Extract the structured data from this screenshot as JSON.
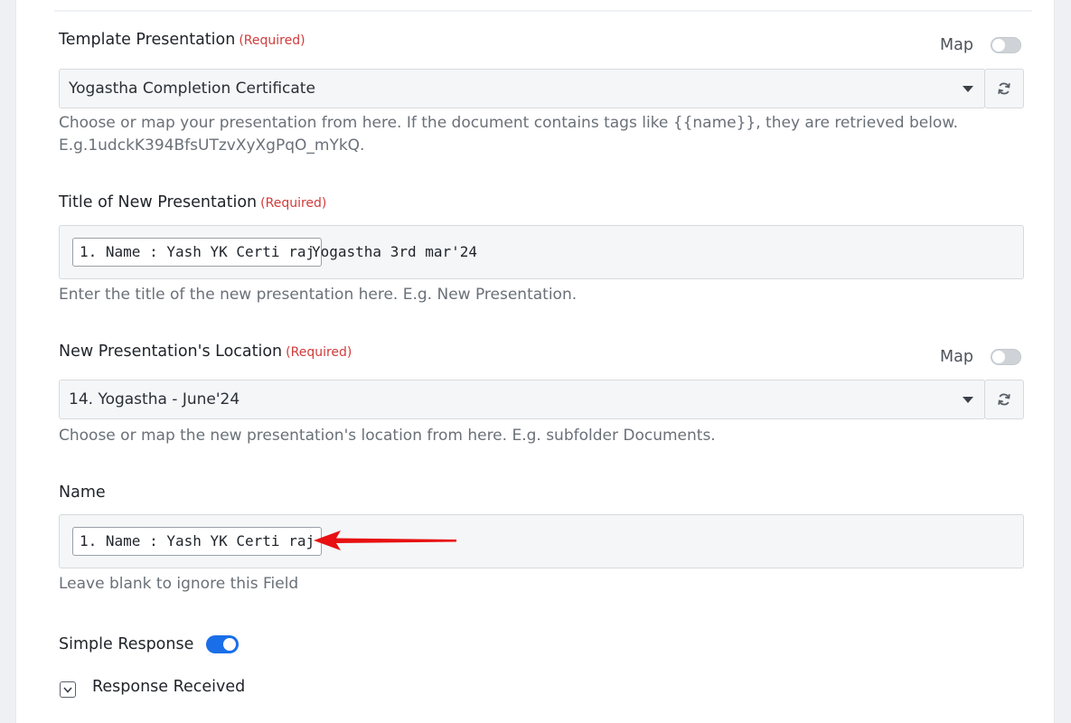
{
  "template_presentation": {
    "label": "Template Presentation",
    "required": "(Required)",
    "map_label": "Map",
    "selected": "Yogastha Completion Certificate",
    "help_line1": "Choose or map your presentation from here. If the document contains tags like {{name}}, they are retrieved below.",
    "help_line2": "E.g.1udckK394BfsUTzvXyXgPqO_mYkQ."
  },
  "title_new_presentation": {
    "label": "Title of New Presentation",
    "required": "(Required)",
    "chip": "1. Name : Yash YK Certi raj",
    "text": "Yogastha 3rd mar'24",
    "help": "Enter the title of the new presentation here. E.g. New Presentation."
  },
  "location": {
    "label": "New Presentation's Location",
    "required": "(Required)",
    "map_label": "Map",
    "selected": "14. Yogastha - June'24",
    "help": "Choose or map the new presentation's location from here. E.g. subfolder Documents."
  },
  "name_field": {
    "label": "Name",
    "chip": "1. Name : Yash YK Certi raj",
    "help": "Leave blank to ignore this Field"
  },
  "simple_response": {
    "label": "Simple Response",
    "enabled": true
  },
  "response_received": {
    "label": "Response Received"
  },
  "colors": {
    "accent": "#1a6fe8",
    "required": "#d13b3b",
    "arrow": "#e81010"
  }
}
